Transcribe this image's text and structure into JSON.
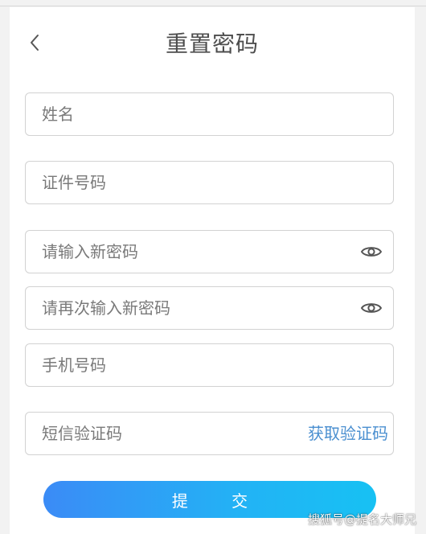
{
  "header": {
    "title": "重置密码"
  },
  "form": {
    "name": {
      "placeholder": "姓名"
    },
    "id_number": {
      "placeholder": "证件号码"
    },
    "new_password": {
      "placeholder": "请输入新密码"
    },
    "confirm_password": {
      "placeholder": "请再次输入新密码"
    },
    "phone": {
      "placeholder": "手机号码"
    },
    "sms_code": {
      "placeholder": "短信验证码",
      "get_code_label": "获取验证码"
    },
    "submit_label": "提 交"
  },
  "icons": {
    "back": "chevron-left-icon",
    "password_visibility": "eye-icon"
  },
  "colors": {
    "link": "#4a8fd0",
    "button_gradient_start": "#3b8bf6",
    "button_gradient_end": "#17c1f3"
  },
  "watermark": "搜狐号@提名大师兄"
}
